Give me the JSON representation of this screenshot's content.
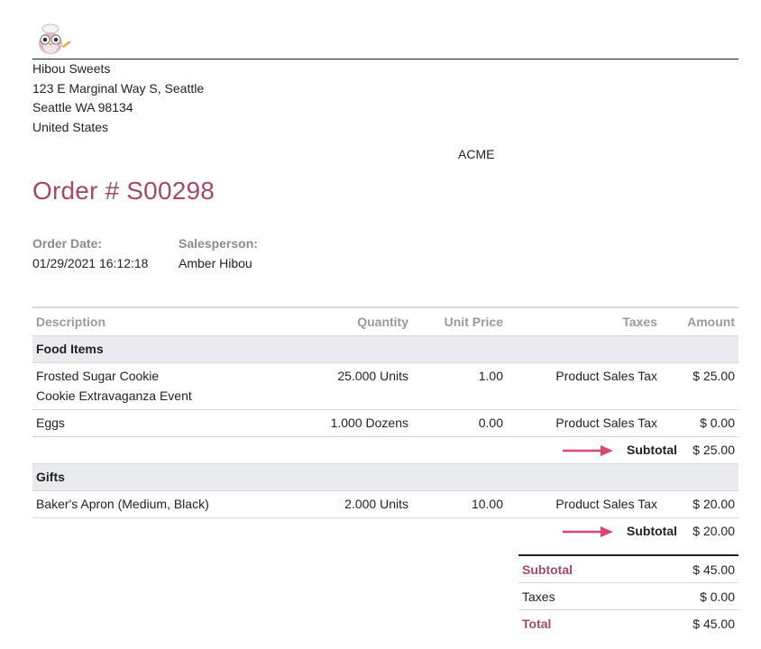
{
  "company": {
    "name": "Hibou Sweets",
    "street": "123 E Marginal Way S, Seattle",
    "city": "Seattle WA 98134",
    "country": "United States",
    "logo_icon": "owl-chef-logo"
  },
  "partner": "ACME",
  "order": {
    "title": "Order # S00298",
    "date_label": "Order Date:",
    "date_value": "01/29/2021 16:12:18",
    "salesperson_label": "Salesperson:",
    "salesperson_value": "Amber Hibou"
  },
  "table": {
    "headers": {
      "description": "Description",
      "quantity": "Quantity",
      "unit_price": "Unit Price",
      "taxes": "Taxes",
      "amount": "Amount"
    },
    "sections": [
      {
        "name": "Food Items",
        "lines": [
          {
            "description": "Frosted Sugar Cookie",
            "description2": "Cookie Extravaganza Event",
            "quantity": "25.000 Units",
            "unit_price": "1.00",
            "taxes": "Product Sales Tax",
            "amount": "$ 25.00"
          },
          {
            "description": "Eggs",
            "quantity": "1.000 Dozens",
            "unit_price": "0.00",
            "taxes": "Product Sales Tax",
            "amount": "$ 0.00"
          }
        ],
        "subtotal_label": "Subtotal",
        "subtotal_value": "$ 25.00"
      },
      {
        "name": "Gifts",
        "lines": [
          {
            "description": "Baker's Apron (Medium, Black)",
            "quantity": "2.000 Units",
            "unit_price": "10.00",
            "taxes": "Product Sales Tax",
            "amount": "$ 20.00"
          }
        ],
        "subtotal_label": "Subtotal",
        "subtotal_value": "$ 20.00"
      }
    ]
  },
  "totals": {
    "subtotal_label": "Subtotal",
    "subtotal_value": "$ 45.00",
    "taxes_label": "Taxes",
    "taxes_value": "$ 0.00",
    "total_label": "Total",
    "total_value": "$ 45.00"
  },
  "colors": {
    "accent": "#a24a68",
    "arrow": "#d9466e",
    "section_bg": "#e9ebee",
    "muted_label": "#8c8c8c"
  }
}
